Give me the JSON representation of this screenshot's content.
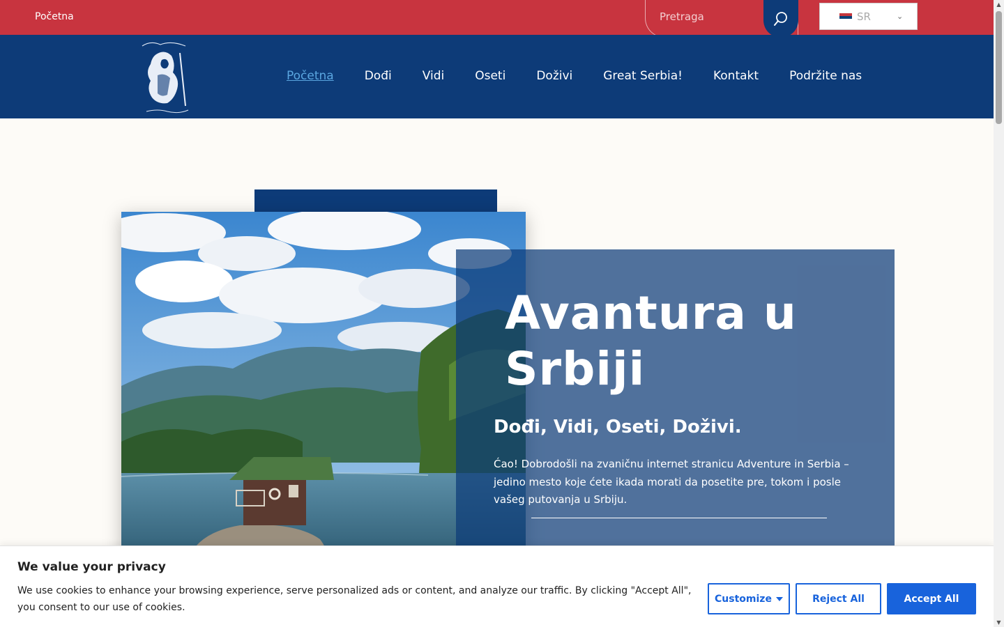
{
  "topbar": {
    "home_link": "Početna",
    "search_placeholder": "Pretraga",
    "language": "SR"
  },
  "nav": {
    "items": [
      {
        "label": "Početna",
        "active": true
      },
      {
        "label": "Dođi"
      },
      {
        "label": "Vidi"
      },
      {
        "label": "Oseti"
      },
      {
        "label": "Doživi"
      },
      {
        "label": "Great Serbia!"
      },
      {
        "label": "Kontakt"
      },
      {
        "label": "Podržite nas"
      }
    ]
  },
  "hero": {
    "title_line1": "Avantura u",
    "title_line2": "Srbiji",
    "subtitle": "Dođi, Vidi, Oseti, Doživi.",
    "text": "Ćao! Dobrodošli na zvaničnu internet stranicu Adventure in Serbia – jedino mesto koje ćete ikada morati da posetite pre, tokom i posle vašeg putovanja u Srbiju."
  },
  "cookie": {
    "title": "We value your privacy",
    "text": "We use cookies to enhance your browsing experience, serve personalized ads or content, and analyze our traffic. By clicking \"Accept All\", you consent to our use of cookies.",
    "customize": "Customize",
    "reject": "Reject All",
    "accept": "Accept All"
  },
  "colors": {
    "topbar": "#c8343f",
    "navbar": "#0d3b78",
    "accent": "#1863dc"
  }
}
